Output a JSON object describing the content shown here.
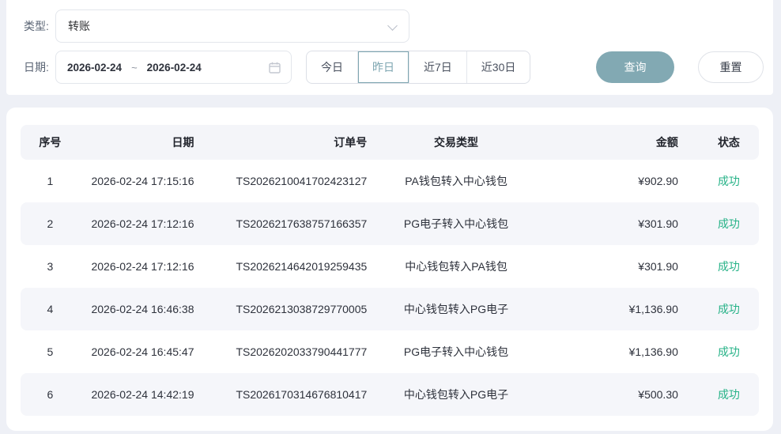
{
  "filters": {
    "type_label": "类型:",
    "type_value": "转账",
    "date_label": "日期:",
    "date_start": "2026-02-24",
    "date_separator": "~",
    "date_end": "2026-02-24",
    "quick_ranges": [
      {
        "label": "今日",
        "selected": false
      },
      {
        "label": "昨日",
        "selected": true
      },
      {
        "label": "近7日",
        "selected": false
      },
      {
        "label": "近30日",
        "selected": false
      }
    ],
    "query_label": "查询",
    "reset_label": "重置"
  },
  "table": {
    "columns": {
      "no": "序号",
      "date": "日期",
      "order": "订单号",
      "type": "交易类型",
      "amount": "金额",
      "status": "状态"
    },
    "rows": [
      {
        "no": "1",
        "date": "2026-02-24 17:15:16",
        "order": "TS2026210041702423127",
        "type": "PA钱包转入中心钱包",
        "amount": "¥902.90",
        "status": "成功"
      },
      {
        "no": "2",
        "date": "2026-02-24 17:12:16",
        "order": "TS2026217638757166357",
        "type": "PG电子转入中心钱包",
        "amount": "¥301.90",
        "status": "成功"
      },
      {
        "no": "3",
        "date": "2026-02-24 17:12:16",
        "order": "TS2026214642019259435",
        "type": "中心钱包转入PA钱包",
        "amount": "¥301.90",
        "status": "成功"
      },
      {
        "no": "4",
        "date": "2026-02-24 16:46:38",
        "order": "TS2026213038729770005",
        "type": "中心钱包转入PG电子",
        "amount": "¥1,136.90",
        "status": "成功"
      },
      {
        "no": "5",
        "date": "2026-02-24 16:45:47",
        "order": "TS2026202033790441777",
        "type": "PG电子转入中心钱包",
        "amount": "¥1,136.90",
        "status": "成功"
      },
      {
        "no": "6",
        "date": "2026-02-24 14:42:19",
        "order": "TS2026170314676810417",
        "type": "中心钱包转入PG电子",
        "amount": "¥500.30",
        "status": "成功"
      }
    ]
  },
  "colors": {
    "query_button_bg": "#82a9b3",
    "selected_range": "#7ea6b1",
    "success_status": "#26b287",
    "page_background": "#eef0f6",
    "stripe_row": "#f5f6fa"
  }
}
